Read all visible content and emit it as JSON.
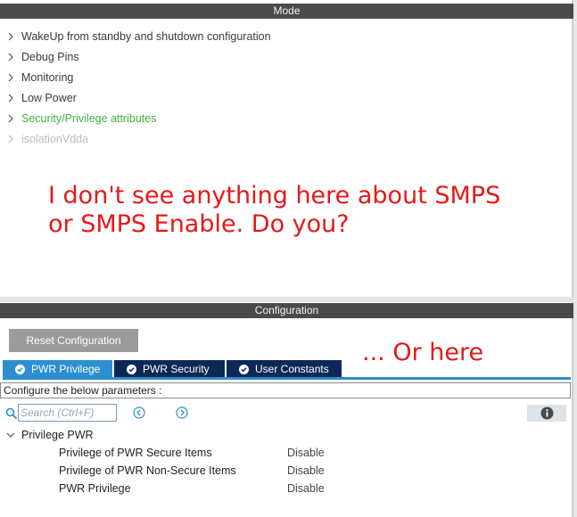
{
  "mode_panel": {
    "title": "Mode",
    "items": [
      {
        "label": "WakeUp from standby and shutdown configuration",
        "state": "normal"
      },
      {
        "label": "Debug Pins",
        "state": "normal"
      },
      {
        "label": "Monitoring",
        "state": "normal"
      },
      {
        "label": "Low Power",
        "state": "normal"
      },
      {
        "label": "Security/Privilege attributes",
        "state": "highlighted"
      },
      {
        "label": "isolationVdda",
        "state": "disabled"
      }
    ]
  },
  "annotations": {
    "mode_note_line1": "I don't see anything here about SMPS",
    "mode_note_line2": "or SMPS Enable. Do you?",
    "config_note": "... Or here"
  },
  "config_panel": {
    "title": "Configuration",
    "reset_label": "Reset Configuration",
    "tabs": [
      {
        "label": "PWR Privilege",
        "active": true
      },
      {
        "label": "PWR Security",
        "active": false
      },
      {
        "label": "User Constants",
        "active": false
      }
    ],
    "instructions": "Configure the below parameters :",
    "search": {
      "placeholder": "Search (Ctrl+F)",
      "value": ""
    },
    "group": {
      "title": "Privilege PWR",
      "params": [
        {
          "name": "Privilege of PWR Secure Items",
          "value": "Disable"
        },
        {
          "name": "Privilege of PWR Non-Secure Items",
          "value": "Disable"
        },
        {
          "name": "PWR Privilege",
          "value": "Disable"
        }
      ]
    }
  },
  "colors": {
    "header_bg": "#4a4a4a",
    "highlight_green": "#3cb43c",
    "disabled_gray": "#b7bcc2",
    "annotation_red": "#e51919",
    "tab_active": "#2d8fd0",
    "tab_inactive": "#0c2956"
  },
  "icons": [
    "chevron-right-icon",
    "chevron-down-icon",
    "check-circle-icon",
    "search-icon",
    "previous-icon",
    "next-icon",
    "info-icon"
  ]
}
